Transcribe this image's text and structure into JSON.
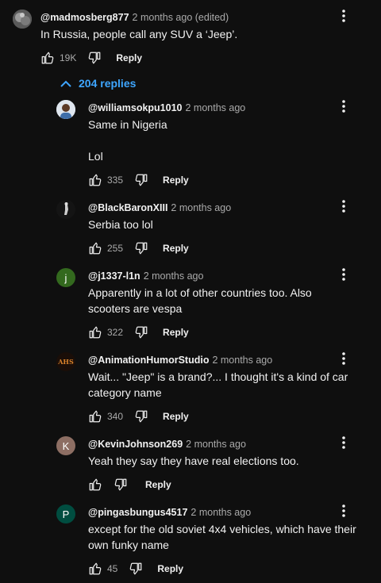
{
  "top_comment": {
    "author": "@madmosberg877",
    "time": "2 months ago (edited)",
    "text": "In Russia, people call any SUV a ‘Jeep’.",
    "likes": "19K",
    "reply_label": "Reply"
  },
  "replies_toggle": {
    "label": "204 replies",
    "color": "#3ea6ff"
  },
  "replies": [
    {
      "author": "@williamsokpu1010",
      "time": "2 months ago",
      "text": "Same in Nigeria\n\nLol",
      "likes": "335",
      "reply_label": "Reply",
      "avatar_icon": "person-photo-avatar"
    },
    {
      "author": "@BlackBaronXIII",
      "time": "2 months ago",
      "text": "Serbia too lol",
      "likes": "255",
      "reply_label": "Reply",
      "avatar_icon": "dark-figure-avatar"
    },
    {
      "author": "@j1337-l1n",
      "time": "2 months ago",
      "text": "Apparently in a lot of other countries too. Also scooters are vespa",
      "likes": "322",
      "reply_label": "Reply",
      "avatar_letter": "j",
      "avatar_color": "#33691e"
    },
    {
      "author": "@AnimationHumorStudio",
      "time": "2 months ago",
      "text": "Wait... \"Jeep\" is a brand?... I thought it's a kind of car category name",
      "likes": "340",
      "reply_label": "Reply",
      "avatar_text": "AHS"
    },
    {
      "author": "@KevinJohnson269",
      "time": "2 months ago",
      "text": "Yeah they say they have real elections too.",
      "likes": "",
      "reply_label": "Reply",
      "avatar_letter": "K",
      "avatar_color": "#8d6e63"
    },
    {
      "author": "@pingasbungus4517",
      "time": "2 months ago",
      "text": "except for the old soviet 4x4 vehicles, which have their own funky name",
      "likes": "45",
      "reply_label": "Reply",
      "avatar_letter": "P",
      "avatar_color": "#004d40"
    }
  ]
}
